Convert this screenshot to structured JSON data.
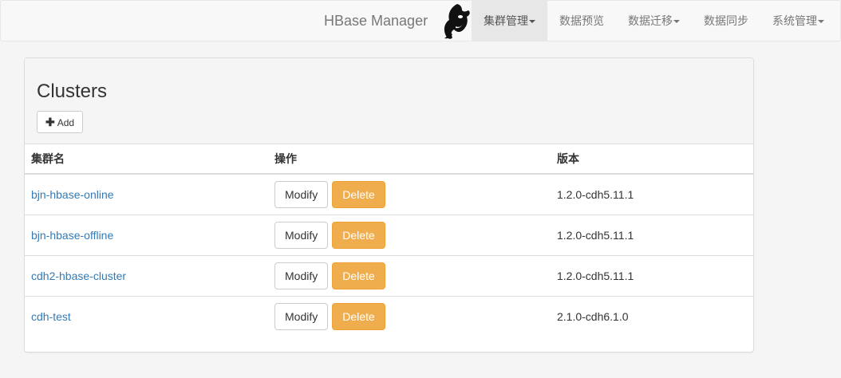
{
  "navbar": {
    "brand": "HBase Manager",
    "items": [
      {
        "label": "集群管理",
        "dropdown": true,
        "active": true
      },
      {
        "label": "数据预览",
        "dropdown": false,
        "active": false
      },
      {
        "label": "数据迁移",
        "dropdown": true,
        "active": false
      },
      {
        "label": "数据同步",
        "dropdown": false,
        "active": false
      },
      {
        "label": "系统管理",
        "dropdown": true,
        "active": false
      }
    ]
  },
  "panel": {
    "title": "Clusters",
    "add_label": "Add"
  },
  "table": {
    "headers": [
      "集群名",
      "操作",
      "版本"
    ],
    "modify_label": "Modify",
    "delete_label": "Delete",
    "rows": [
      {
        "name": "bjn-hbase-online",
        "version": "1.2.0-cdh5.11.1"
      },
      {
        "name": "bjn-hbase-offline",
        "version": "1.2.0-cdh5.11.1"
      },
      {
        "name": "cdh2-hbase-cluster",
        "version": "1.2.0-cdh5.11.1"
      },
      {
        "name": "cdh-test",
        "version": "2.1.0-cdh6.1.0"
      }
    ]
  },
  "colors": {
    "link": "#337ab7",
    "warning": "#f0ad4e",
    "navbar_bg": "#f8f8f8"
  }
}
